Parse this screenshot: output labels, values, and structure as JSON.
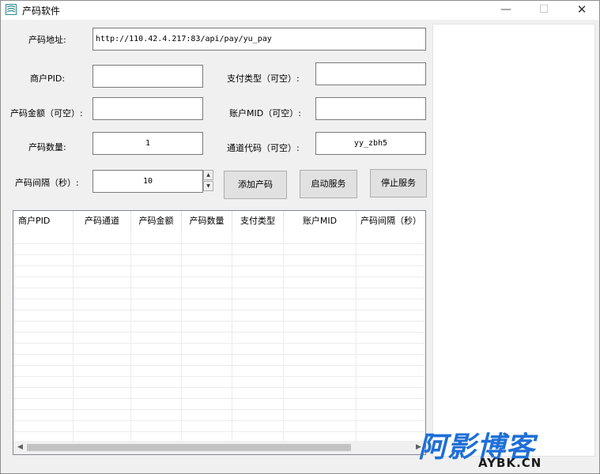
{
  "window": {
    "title": "产码软件",
    "controls": {
      "minimize": "—",
      "maximize": "☐",
      "close": "✕"
    }
  },
  "form": {
    "url_label": "产码地址:",
    "url_value": "http://110.42.4.217:83/api/pay/yu_pay",
    "pid_label": "商户PID:",
    "pid_value": "",
    "paytype_label": "支付类型（可空）:",
    "paytype_value": "",
    "amount_label": "产码金额（可空）:",
    "amount_value": "",
    "mid_label": "账户MID（可空）:",
    "mid_value": "",
    "count_label": "产码数量:",
    "count_value": "1",
    "channel_label": "通道代码（可空）:",
    "channel_value": "yy_zbh5",
    "interval_label": "产码间隔（秒）:",
    "interval_value": "10"
  },
  "buttons": {
    "add": "添加产码",
    "start": "启动服务",
    "stop": "停止服务"
  },
  "table": {
    "columns": [
      "商户PID",
      "产码通道",
      "产码金额",
      "产码数量",
      "支付类型",
      "账户MID",
      "产码间隔（秒）"
    ],
    "rows": []
  },
  "scrollbar": {
    "left_arrow": "◀",
    "right_arrow": "▶"
  },
  "icons": {
    "app": "app-logo-icon",
    "spin_up": "▲",
    "spin_down": "▼"
  },
  "watermark": {
    "title": "阿影博客",
    "subtitle": "AYBK.CN"
  }
}
